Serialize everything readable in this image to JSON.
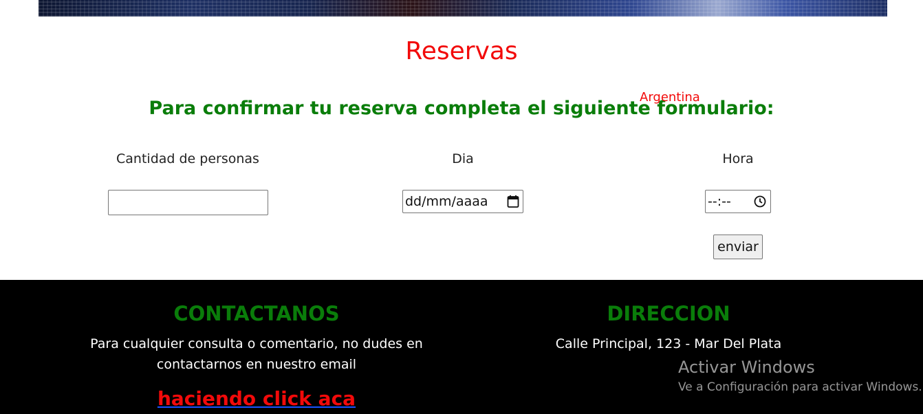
{
  "page": {
    "title": "Reservas",
    "subtitle": "Para confirmar tu reserva completa el siguiente formulario:"
  },
  "form": {
    "personas": {
      "label": "Cantidad de personas",
      "value": ""
    },
    "dia": {
      "label": "Dia",
      "placeholder": "dd/mm/aaaa",
      "icon": "calendar-icon"
    },
    "hora": {
      "label": "Hora",
      "placeholder": "--:--",
      "icon": "clock-icon"
    },
    "submit_label": "enviar"
  },
  "footer": {
    "contact": {
      "heading": "CONTACTANOS",
      "text": "Para cualquier consulta o comentario, no dudes en contactarnos en nuestro email",
      "link_text": "haciendo click aca"
    },
    "address": {
      "heading": "DIRECCION",
      "text": "Calle Principal, 123 - Mar Del Plata",
      "country": "Argentina"
    }
  },
  "watermark": {
    "title": "Activar Windows",
    "subtitle": "Ve a Configuración para activar Windows."
  },
  "colors": {
    "title": "#f20a0a",
    "subtitle": "#0a7d0a",
    "footer_bg": "#000000",
    "link": "#f20a0a",
    "link_underline": "#1a54ff"
  }
}
